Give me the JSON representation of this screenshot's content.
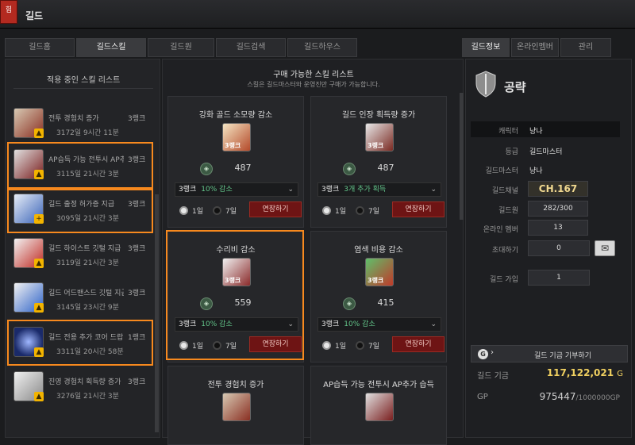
{
  "window": {
    "title": "길드",
    "badge": "힘"
  },
  "tabs": [
    "길드홈",
    "길드스킬",
    "길드원",
    "길드검색",
    "길드하우스"
  ],
  "right_tabs": [
    "길드정보",
    "온라인멤버",
    "관리"
  ],
  "left_panel": {
    "heading": "적용 중인 스킬 리스트",
    "items": [
      {
        "name": "전투 경험치 증가",
        "rank": "3랭크",
        "time": "3172일 9시간 11분",
        "icon": "sword-shield-icon"
      },
      {
        "name": "AP습득 가능 전투시 AP추가 습득",
        "rank": "3랭크",
        "time": "3115일 21시간 3분",
        "icon": "dumbbell-icon"
      },
      {
        "name": "길드 출정 허가증 지급",
        "rank": "3랭크",
        "time": "3095일 21시간 3분",
        "icon": "permit-icon"
      },
      {
        "name": "길드 하이스트 깃털 지급",
        "rank": "3랭크",
        "time": "3119일 21시간 3분",
        "icon": "feather-icon"
      },
      {
        "name": "길드 어드밴스드 깃털 지급",
        "rank": "3랭크",
        "time": "3145일 23시간 9분",
        "icon": "feather-blue-icon"
      },
      {
        "name": "길드 전용 추가 코어 드랍 1랭크",
        "rank": "1랭크",
        "time": "3311일 20시간 58분",
        "icon": "core-icon"
      },
      {
        "name": "진영 경험치 획득량 증가",
        "rank": "3랭크",
        "time": "3276일 21시간 3분",
        "icon": "knight-helmet-icon"
      }
    ]
  },
  "mid_panel": {
    "title": "구매 가능한 스킬 리스트",
    "subtitle": "스킬은 길드마스터와 운영진만 구매가 가능합니다.",
    "cards": [
      {
        "name": "강화 골드 소모량 감소",
        "icon_rank": "3랭크",
        "cost": "487",
        "rank": "3랭크",
        "effect": "10% 감소",
        "opt1": "1일",
        "opt2": "7일",
        "btn": "연장하기",
        "icon": "gold-hammer-icon"
      },
      {
        "name": "길드 인장 획득량 증가",
        "icon_rank": "3랭크",
        "cost": "487",
        "rank": "3랭크",
        "effect": "3개 추가 획득",
        "opt1": "1일",
        "opt2": "7일",
        "btn": "연장하기",
        "icon": "seal-anvil-icon"
      },
      {
        "name": "수리비 감소",
        "icon_rank": "3랭크",
        "cost": "559",
        "rank": "3랭크",
        "effect": "10% 감소",
        "opt1": "1일",
        "opt2": "7일",
        "btn": "연장하기",
        "icon": "repair-hammer-icon"
      },
      {
        "name": "염색 비용 감소",
        "icon_rank": "3랭크",
        "cost": "415",
        "rank": "3랭크",
        "effect": "10% 감소",
        "opt1": "1일",
        "opt2": "7일",
        "btn": "연장하기",
        "icon": "dye-pots-icon"
      },
      {
        "name": "전투 경험치 증가",
        "icon": "sword-shield-icon"
      },
      {
        "name": "AP습득 가능 전투시 AP추가 습득",
        "icon": "dumbbell-icon"
      }
    ]
  },
  "right_panel": {
    "guild_name": "공략",
    "rows": [
      {
        "label": "캐릭터",
        "value": "냥나"
      },
      {
        "label": "등급",
        "value": "길드마스터"
      },
      {
        "label": "길드마스터",
        "value": "냥나"
      }
    ],
    "channel_label": "길드채널",
    "channel": "CH.167",
    "members_label": "길드원",
    "members": "282/300",
    "online_label": "온라인 멤버",
    "online": "13",
    "invite_label": "초대하기",
    "invite": "0",
    "join_label": "길드 가입",
    "join": "1",
    "donate_label": "길드 기금 기부하기",
    "fund_label": "길드 기금",
    "fund": "117,122,021",
    "fund_unit": "G",
    "gp_label": "GP",
    "gp": "975447",
    "gp_max": "/1000000GP"
  },
  "colors": {
    "highlight": "#f7891e",
    "extend_btn": "#6e1414",
    "effect_text": "#63c58a",
    "fund_text": "#f0d060"
  }
}
